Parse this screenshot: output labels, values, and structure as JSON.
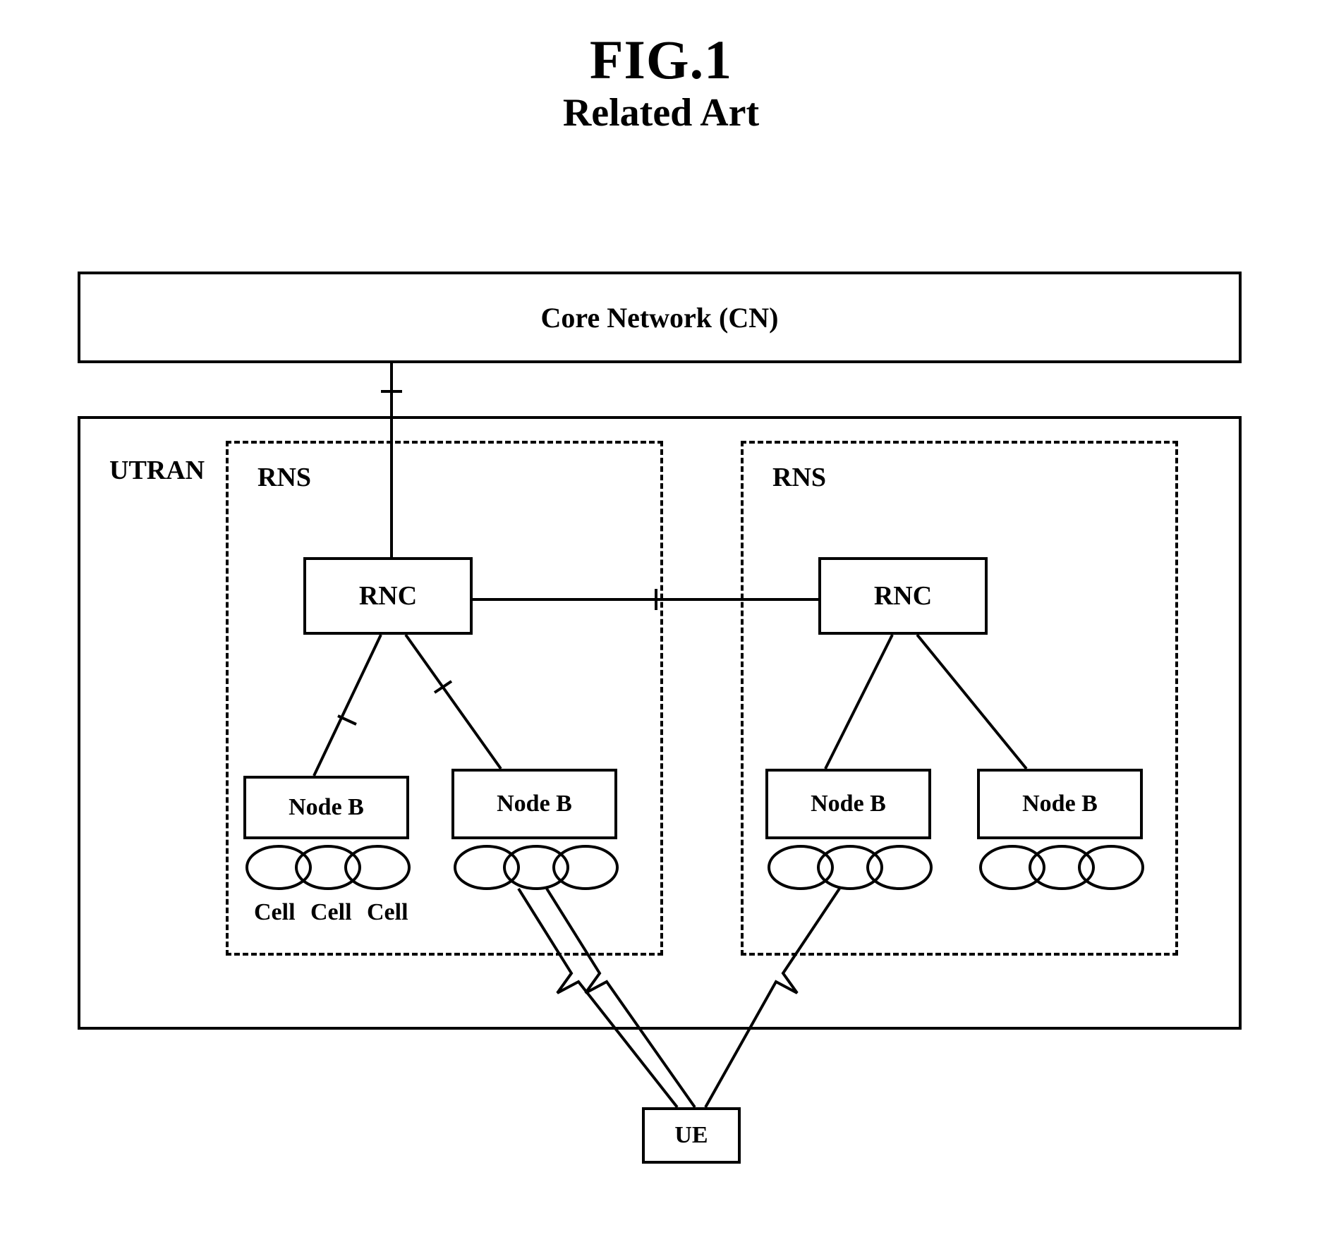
{
  "figure": {
    "title_main": "FIG.1",
    "title_sub": "Related Art"
  },
  "labels": {
    "core_network": "Core Network (CN)",
    "utran": "UTRAN",
    "rns_left": "RNS",
    "rns_right": "RNS",
    "rnc_left": "RNC",
    "rnc_right": "RNC",
    "nodeb_1": "Node B",
    "nodeb_2": "Node B",
    "nodeb_3": "Node B",
    "nodeb_4": "Node B",
    "cell_1": "Cell",
    "cell_2": "Cell",
    "cell_3": "Cell",
    "ue": "UE"
  }
}
